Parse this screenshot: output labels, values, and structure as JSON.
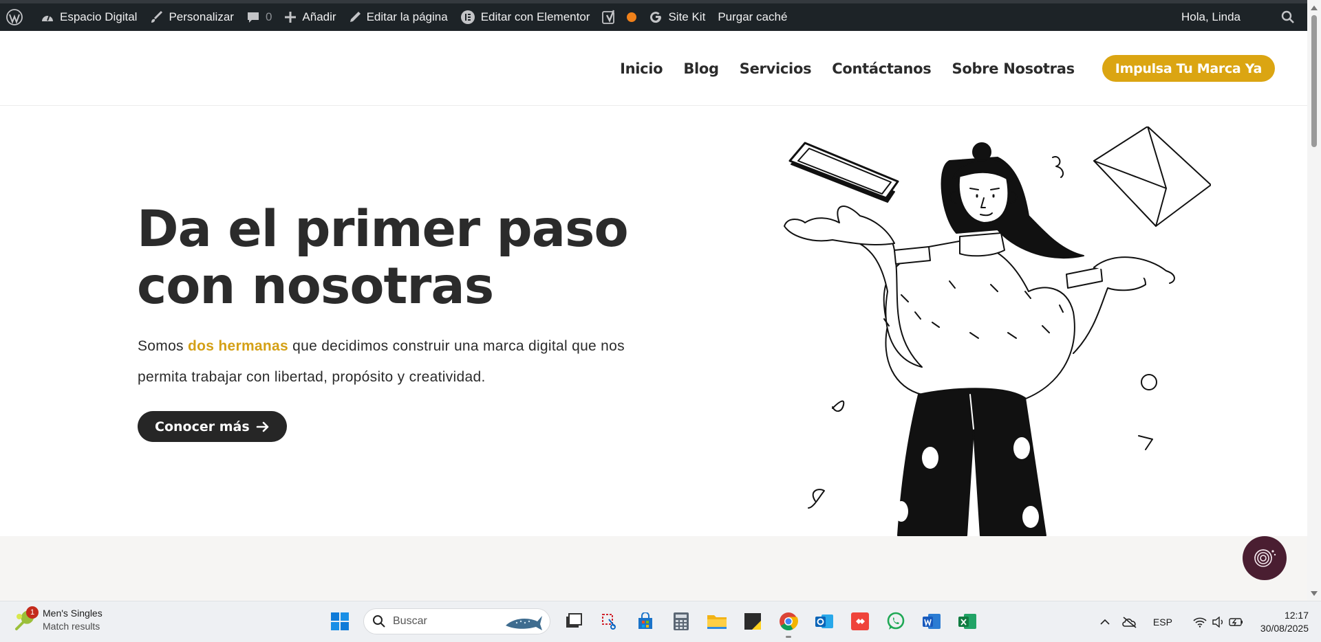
{
  "admin_bar": {
    "site_name": "Espacio Digital",
    "customize": "Personalizar",
    "comments_count": "0",
    "add_new": "Añadir",
    "edit_page": "Editar la página",
    "edit_elementor": "Editar con Elementor",
    "site_kit": "Site Kit",
    "purge_cache": "Purgar caché",
    "greeting": "Hola, Linda"
  },
  "nav": {
    "items": [
      "Inicio",
      "Blog",
      "Servicios",
      "Contáctanos",
      "Sobre Nosotras"
    ],
    "cta": "Impulsa Tu Marca Ya"
  },
  "hero": {
    "title_line1": "Da el primer paso",
    "title_line2": "con nosotras",
    "text_before": "Somos ",
    "text_highlight": "dos hermanas",
    "text_after": " que decidimos construir una marca digital que nos permita trabajar con libertad, propósito y creatividad.",
    "button": "Conocer más"
  },
  "taskbar": {
    "notification_count": "1",
    "notification_title": "Men's Singles",
    "notification_sub": "Match results",
    "search_placeholder": "Buscar",
    "language": "ESP",
    "time": "12:17",
    "date": "30/08/2025"
  },
  "colors": {
    "accent": "#dba512",
    "dark": "#262626",
    "admin_bar": "#1d2327"
  }
}
